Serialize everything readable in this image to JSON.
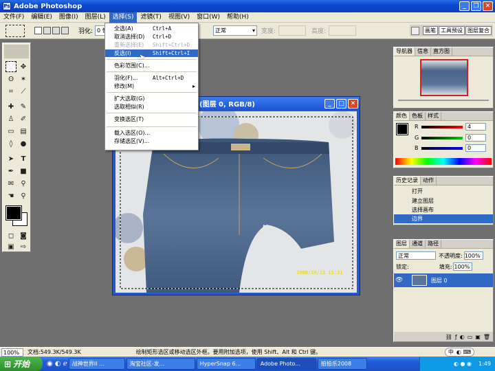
{
  "app": {
    "title": "Adobe Photoshop"
  },
  "menubar": [
    "文件(F)",
    "编辑(E)",
    "图像(I)",
    "图层(L)",
    "选择(S)",
    "滤镜(T)",
    "视图(V)",
    "窗口(W)",
    "帮助(H)"
  ],
  "optbar": {
    "feather_label": "羽化:",
    "feather_value": "0 像",
    "style_value": "正常",
    "width_label": "宽度:",
    "height_label": "高度:"
  },
  "palette_well": [
    "画笔",
    "工具预设",
    "图层复合"
  ],
  "select_menu": {
    "items": [
      {
        "label": "全选(A)",
        "shortcut": "Ctrl+A"
      },
      {
        "label": "取消选择(D)",
        "shortcut": "Ctrl+D"
      },
      {
        "label": "重新选择(E)",
        "shortcut": "Shift+Ctrl+D",
        "disabled": true
      },
      {
        "label": "反选(I)",
        "shortcut": "Shift+Ctrl+I",
        "highlighted": true
      },
      {
        "label": "色彩范围(C)..."
      },
      {
        "label": "羽化(F)...",
        "shortcut": "Alt+Ctrl+D"
      },
      {
        "label": "修改(M)",
        "submenu": "▸"
      },
      {
        "label": "扩大选取(G)"
      },
      {
        "label": "选取相似(R)"
      },
      {
        "label": "变换选区(T)"
      },
      {
        "label": "载入选区(O)..."
      },
      {
        "label": "存储选区(V)..."
      }
    ]
  },
  "document": {
    "title": "(图层 0, RGB/8)",
    "timestamp": "2008/10/13 15:31"
  },
  "navigator": {
    "tabs": [
      "导航器",
      "信息",
      "直方图"
    ]
  },
  "color_panel": {
    "tabs": [
      "颜色",
      "色板",
      "样式"
    ],
    "r_label": "R",
    "g_label": "G",
    "b_label": "B",
    "r": "4",
    "g": "0",
    "b": "0"
  },
  "history": {
    "tabs": [
      "历史记录",
      "动作"
    ],
    "items": [
      "打开",
      "建立图层",
      "选择画布",
      "边界"
    ]
  },
  "layers": {
    "tabs": [
      "图层",
      "通道",
      "路径"
    ],
    "blend": "正常",
    "opacity_label": "不透明度:",
    "opacity": "100%",
    "lock_label": "锁定:",
    "fill_label": "填充:",
    "fill": "100%",
    "layer_name": "图层 0"
  },
  "status": {
    "zoom": "100%",
    "doc": "文档:549.3K/549.3K",
    "hint": "绘制矩形选区或移动选区外框。要用附加选项，使用 Shift、Alt 和 Ctrl 键。"
  },
  "taskbar": {
    "start": "开始",
    "tasks": [
      "战神世界II ...",
      "淘宝社区-发...",
      "HyperSnap 6...",
      "Adobe Photo...",
      "拍拍乐2008"
    ],
    "time": "1:49",
    "ime": "中"
  },
  "colors": {
    "accent": "#316ac5",
    "xp_blue": "#245edb",
    "start_green": "#2f8e2b"
  }
}
